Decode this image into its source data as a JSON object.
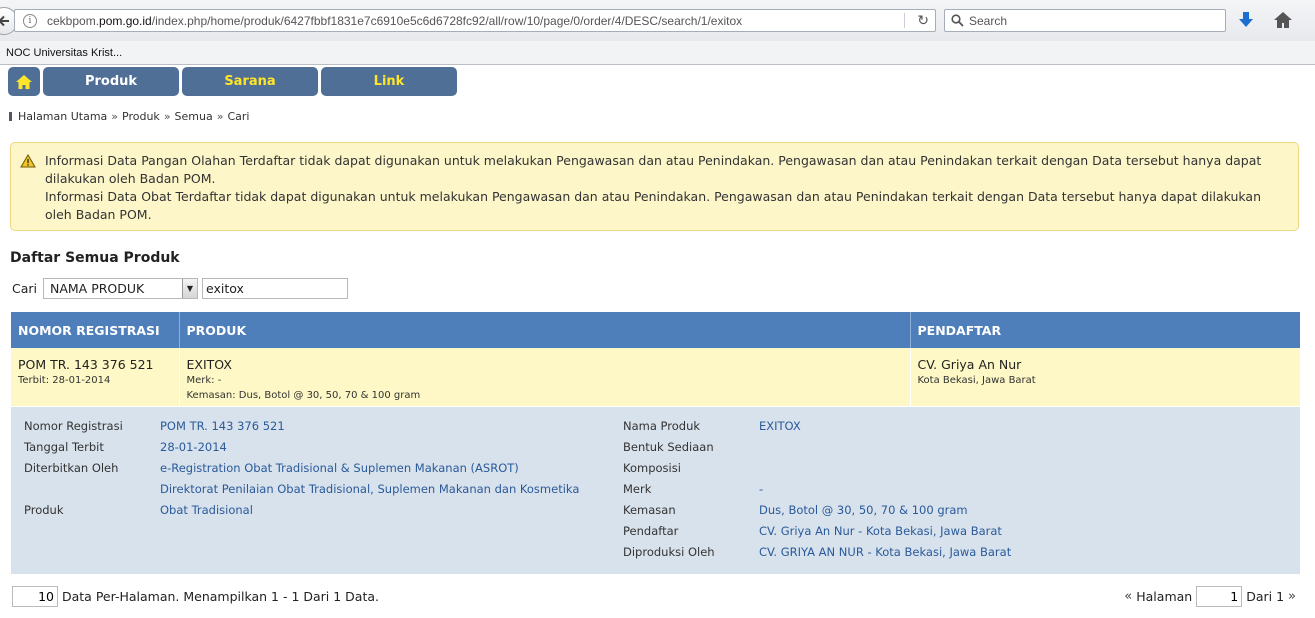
{
  "browser": {
    "url_prefix": "cekbpom.",
    "url_domain": "pom.go.id",
    "url_path": "/index.php/home/produk/6427fbbf1831e7c6910e5c6d6728fc92/all/row/10/page/0/order/4/DESC/search/1/exitox",
    "search_placeholder": "Search",
    "bookmark": "NOC Universitas Krist..."
  },
  "nav": {
    "tabs": [
      "Produk",
      "Sarana",
      "Link"
    ]
  },
  "breadcrumb": [
    "Halaman Utama",
    "Produk",
    "Semua",
    "Cari"
  ],
  "notice": {
    "line1": "Informasi Data Pangan Olahan Terdaftar tidak dapat digunakan untuk melakukan Pengawasan dan atau Penindakan. Pengawasan dan atau Penindakan terkait dengan Data tersebut hanya dapat dilakukan oleh Badan POM.",
    "line2": "Informasi Data Obat Terdaftar tidak dapat digunakan untuk melakukan Pengawasan dan atau Penindakan. Pengawasan dan atau Penindakan terkait dengan Data tersebut hanya dapat dilakukan oleh Badan POM."
  },
  "list_title": "Daftar Semua Produk",
  "search": {
    "label": "Cari",
    "field": "NAMA PRODUK",
    "value": "exitox"
  },
  "table": {
    "headers": [
      "NOMOR REGISTRASI",
      "PRODUK",
      "PENDAFTAR"
    ],
    "row": {
      "reg_no": "POM TR. 143 376 521",
      "terbit": "Terbit: 28-01-2014",
      "product": "EXITOX",
      "merk": "Merk: -",
      "kemasan": "Kemasan: Dus, Botol @ 30, 50, 70 & 100 gram",
      "registrant": "CV. Griya An Nur",
      "registrant_city": "Kota Bekasi, Jawa Barat"
    }
  },
  "detail": {
    "left": [
      {
        "k": "Nomor Registrasi",
        "v": "POM TR. 143 376 521"
      },
      {
        "k": "Tanggal Terbit",
        "v": "28-01-2014"
      },
      {
        "k": "Diterbitkan Oleh",
        "v": "e-Registration Obat Tradisional & Suplemen Makanan (ASROT)"
      },
      {
        "k": "",
        "v": "Direktorat Penilaian Obat Tradisional, Suplemen Makanan dan Kosmetika"
      },
      {
        "k": "Produk",
        "v": "Obat Tradisional"
      }
    ],
    "right": [
      {
        "k": "Nama Produk",
        "v": "EXITOX"
      },
      {
        "k": "Bentuk Sediaan",
        "v": ""
      },
      {
        "k": "Komposisi",
        "v": ""
      },
      {
        "k": "Merk",
        "v": "-"
      },
      {
        "k": "Kemasan",
        "v": "Dus, Botol @ 30, 50, 70 & 100 gram"
      },
      {
        "k": "Pendaftar",
        "v": "CV. Griya An Nur - Kota Bekasi, Jawa Barat"
      },
      {
        "k": "Diproduksi Oleh",
        "v": "CV. GRIYA AN NUR - Kota Bekasi, Jawa Barat"
      }
    ]
  },
  "footer": {
    "per_page": "10",
    "summary": "Data Per-Halaman. Menampilkan 1 - 1 Dari 1 Data.",
    "halaman_label": "Halaman",
    "page": "1",
    "of_label": "Dari 1",
    "prev_icon": "«",
    "next_icon": "»"
  }
}
